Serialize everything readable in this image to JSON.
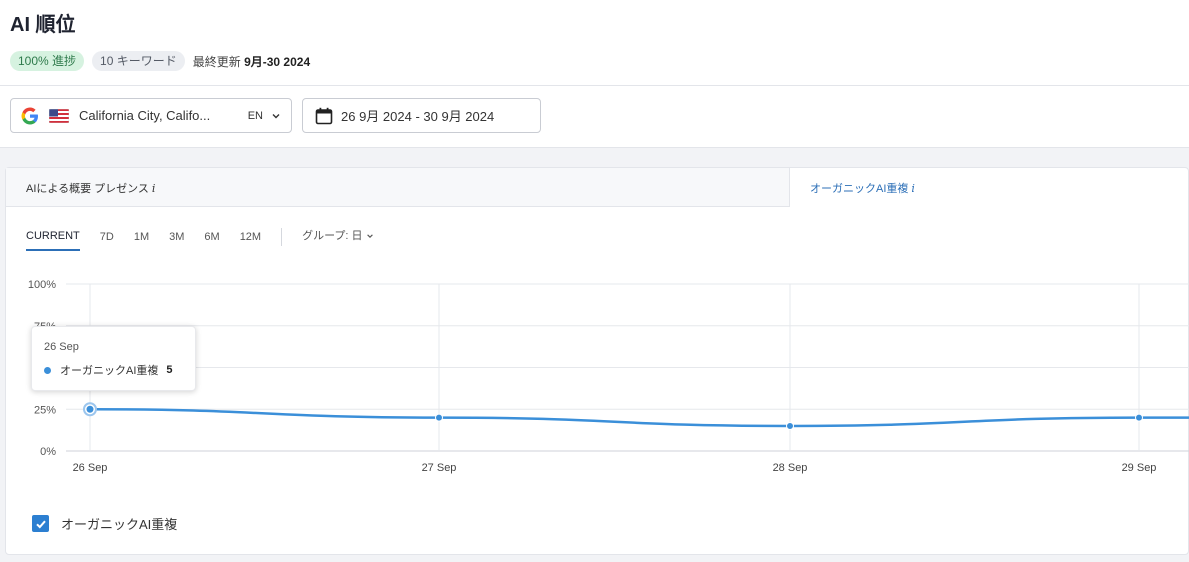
{
  "page": {
    "title": "AI 順位",
    "progress_badge": "100% 進捗",
    "keywords_badge": "10 キーワード",
    "updated_label": "最終更新",
    "updated_value": "9月-30 2024"
  },
  "filters": {
    "location": "California City, Califo...",
    "language": "EN",
    "date_range": "26 9月 2024 - 30 9月 2024",
    "icons": [
      "google-icon",
      "us-flag-icon",
      "chevron-down-icon",
      "calendar-icon"
    ]
  },
  "tabs": {
    "left": "AIによる概要 プレゼンス",
    "right": "オーガニックAI重複",
    "info_glyph": "i"
  },
  "ranges": [
    "CURRENT",
    "7D",
    "1M",
    "3M",
    "6M",
    "12M"
  ],
  "active_range": "CURRENT",
  "group_label": "グループ: 日",
  "tooltip": {
    "date": "26 Sep",
    "series": "オーガニックAI重複",
    "value": "5"
  },
  "legend": {
    "label": "オーガニックAI重複",
    "checked": true
  },
  "colors": {
    "accent": "#2c6fb7",
    "series": "#3b8fd9",
    "progress_bg": "#d6f2e0",
    "progress_text": "#2e7a4b"
  },
  "chart_data": {
    "type": "line",
    "categories": [
      "26 Sep",
      "27 Sep",
      "28 Sep",
      "29 Sep"
    ],
    "series": [
      {
        "name": "オーガニックAI重複",
        "values": [
          25,
          20,
          15,
          20
        ]
      }
    ],
    "y_ticks": [
      "0%",
      "25%",
      "75%",
      "100%"
    ],
    "ylim": [
      0,
      100
    ],
    "grid": true
  }
}
